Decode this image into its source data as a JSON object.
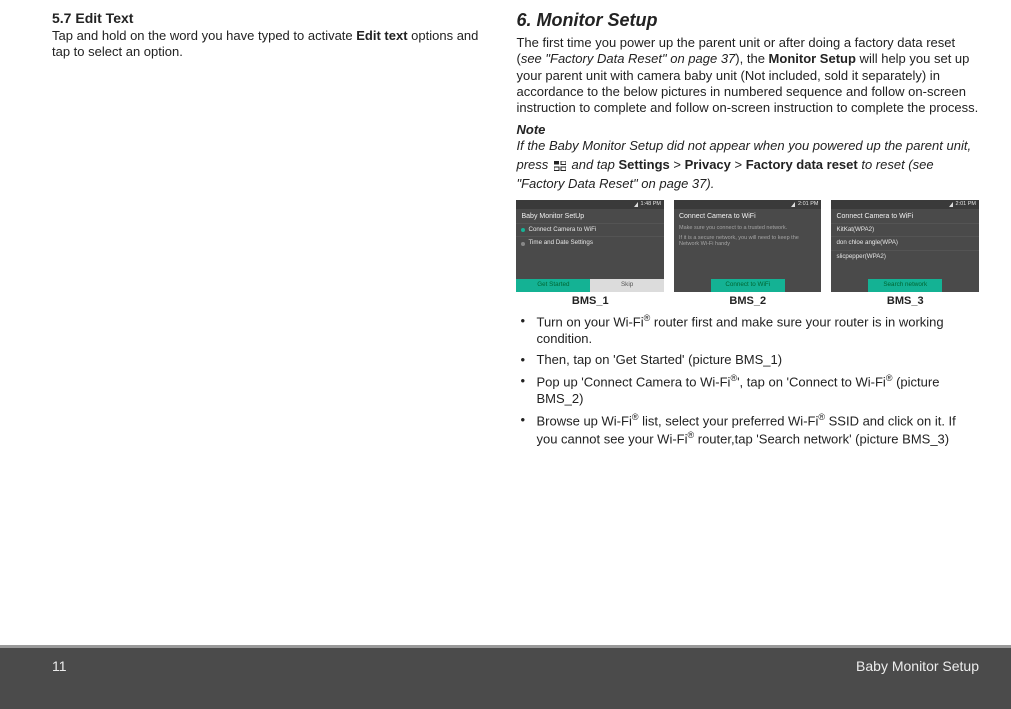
{
  "left": {
    "heading": "5.7     Edit Text",
    "paragraph_pre": "Tap and hold on the word you have typed to activate ",
    "paragraph_bold": "Edit text",
    "paragraph_post": " options and tap to select an option."
  },
  "right": {
    "heading": "6.   Monitor Setup",
    "intro_1": "The first time you power up the parent unit or after doing a factory data reset (",
    "intro_italic": "see \"Factory Data Reset\" on page",
    "intro_pagenum": " 37",
    "intro_2": "), the ",
    "intro_bold": "Monitor Setup",
    "intro_3": " will help you set up your parent unit with camera baby unit (Not included, sold it separately) in accordance to the below pictures in numbered sequence and follow on-screen instruction to complete and follow on-screen instruction to complete the process.",
    "note_heading": "Note",
    "note_1": "If the Baby Monitor Setup did not appear when you powered up the parent unit, press ",
    "note_tap": " and tap ",
    "note_settings": "Settings",
    "note_gt1": " > ",
    "note_privacy": "Privacy",
    "note_gt2": " > ",
    "note_fdr": "Factory data reset",
    "note_2": " to reset (see \"Factory Data Reset\" on page 37).",
    "screens": {
      "s1": {
        "time": "1:48 PM",
        "title": "Baby Monitor SetUp",
        "row1": "Connect Camera to WiFi",
        "row2": "Time and Date Settings",
        "btn_left": "Get Started",
        "btn_right": "Skip",
        "caption": "BMS_1"
      },
      "s2": {
        "time": "2:01 PM",
        "title": "Connect Camera to WiFi",
        "hint1": "Make sure you connect to a trusted network.",
        "hint2": "If it is a secure network, you will need to keep the Network Wi-Fi handy",
        "btn": "Connect to WiFi",
        "caption": "BMS_2"
      },
      "s3": {
        "time": "2:01 PM",
        "title": "Connect Camera to WiFi",
        "row1": "KitKat(WPA2)",
        "row2": "don chloe angle(WPA)",
        "row3": "slicpepper(WPA2)",
        "btn": "Search network",
        "caption": "BMS_3"
      }
    },
    "bullets": {
      "b1": "Turn on your Wi-Fi® router first and make sure your router is in working condition.",
      "b2": "Then, tap on 'Get Started' (picture BMS_1)",
      "b3": "Pop up 'Connect Camera to Wi-Fi®', tap on 'Connect to Wi-Fi® (picture BMS_2)",
      "b4": "Browse up Wi-Fi® list, select your preferred Wi-Fi® SSID and click on it. If you cannot see your Wi-Fi® router,tap 'Search network' (picture BMS_3)"
    }
  },
  "footer": {
    "page": "11",
    "title": "Baby Monitor Setup"
  }
}
